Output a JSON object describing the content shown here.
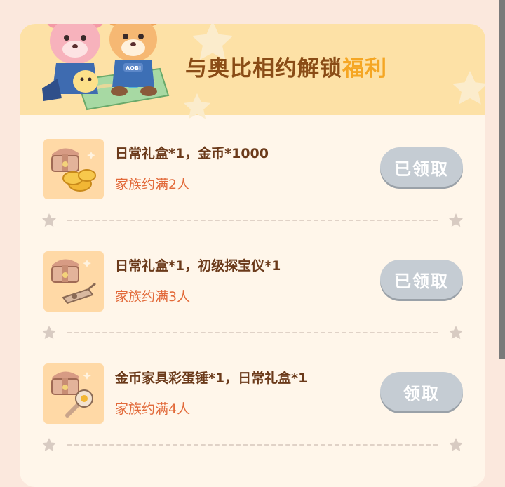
{
  "banner": {
    "title_main": "与奥比相约解锁",
    "title_accent": "福利",
    "mascot_badge": "AOBI"
  },
  "rewards": [
    {
      "items": "日常礼盒*1，金币*1000",
      "condition": "家族约满2人",
      "button": "已领取",
      "button_state": "claimed"
    },
    {
      "items": "日常礼盒*1，初级探宝仪*1",
      "condition": "家族约满3人",
      "button": "已领取",
      "button_state": "claimed"
    },
    {
      "items": "金币家具彩蛋锤*1，日常礼盒*1",
      "condition": "家族约满4人",
      "button": "领取",
      "button_state": "available"
    }
  ],
  "colors": {
    "page_bg": "#fbe8dd",
    "header_bg": "#fde1a6",
    "title_brown": "#8a4c16",
    "title_accent": "#f5a623",
    "condition_text": "#e26a3a",
    "button_gray": "#c5ccd3"
  }
}
